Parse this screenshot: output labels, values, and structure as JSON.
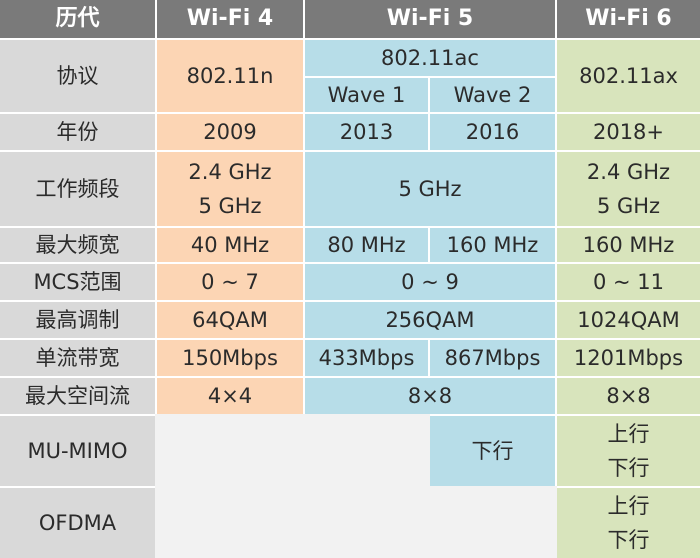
{
  "headers": {
    "generation": "历代",
    "wifi4": "Wi-Fi 4",
    "wifi5": "Wi-Fi 5",
    "wifi6": "Wi-Fi 6"
  },
  "rows": {
    "protocol": {
      "label": "协议",
      "wifi4": "802.11n",
      "wifi5": "802.11ac",
      "wave1": "Wave 1",
      "wave2": "Wave 2",
      "wifi6": "802.11ax"
    },
    "year": {
      "label": "年份",
      "wifi4": "2009",
      "wave1": "2013",
      "wave2": "2016",
      "wifi6": "2018+"
    },
    "band": {
      "label": "工作频段",
      "wifi4": [
        "2.4 GHz",
        "5 GHz"
      ],
      "wifi5": "5 GHz",
      "wifi6": [
        "2.4 GHz",
        "5 GHz"
      ]
    },
    "max_width": {
      "label": "最大频宽",
      "wifi4": "40 MHz",
      "wave1": "80 MHz",
      "wave2": "160 MHz",
      "wifi6": "160 MHz"
    },
    "mcs": {
      "label": "MCS范围",
      "wifi4": "0 ~ 7",
      "wifi5": "0 ~ 9",
      "wifi6": "0 ~ 11"
    },
    "modulation": {
      "label": "最高调制",
      "wifi4": "64QAM",
      "wifi5": "256QAM",
      "wifi6": "1024QAM"
    },
    "stream_bw": {
      "label": "单流带宽",
      "wifi4": "150Mbps",
      "wave1": "433Mbps",
      "wave2": "867Mbps",
      "wifi6": "1201Mbps"
    },
    "spatial": {
      "label": "最大空间流",
      "wifi4": "4×4",
      "wifi5": "8×8",
      "wifi6": "8×8"
    },
    "mumimo": {
      "label": "MU-MIMO",
      "wave2": "下行",
      "wifi6": [
        "上行",
        "下行"
      ]
    },
    "ofdma": {
      "label": "OFDMA",
      "wifi6": [
        "上行",
        "下行"
      ]
    }
  }
}
